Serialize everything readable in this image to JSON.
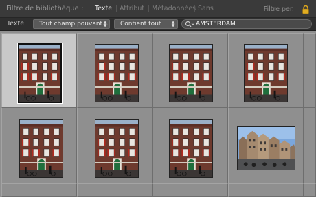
{
  "header": {
    "title": "Filtre de bibliothèque :",
    "tabs": [
      "Texte",
      "Attribut",
      "Métadonnées",
      "Sans"
    ],
    "active_tab": "Texte",
    "preset_label": "Filtre per..."
  },
  "filter": {
    "label": "Texte",
    "field_select": "Tout champ pouvant...",
    "rule_select": "Contient tout",
    "search_value": "AMSTERDAM"
  },
  "colors": {
    "active_tab": "#e8e8e8",
    "inactive_tab": "#7c7c7c",
    "selected_cell": "#c8c8c8",
    "grid_bg": "#8f8f8f"
  }
}
